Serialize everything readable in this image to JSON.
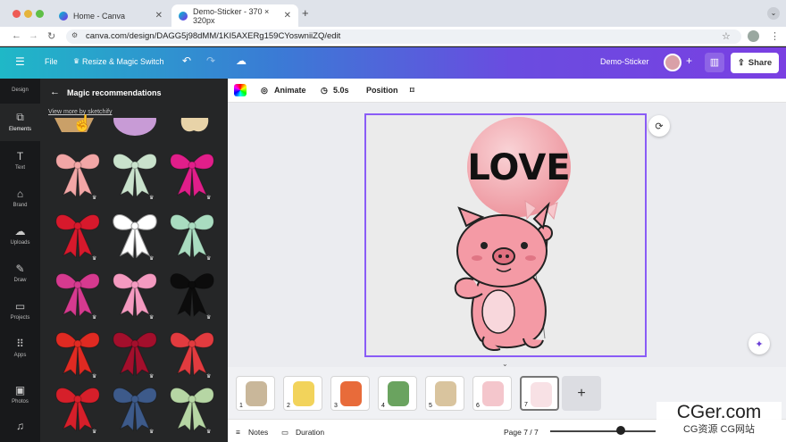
{
  "browser": {
    "tabs": [
      {
        "title": "Home - Canva",
        "active": false
      },
      {
        "title": "Demo-Sticker - 370 × 320px",
        "active": true
      }
    ],
    "new_tab": "+",
    "url": "canva.com/design/DAGG5j98dMM/1KI5AXERg159CYoswniiZQ/edit"
  },
  "topbar": {
    "menu_icon": "hamburger-icon",
    "file": "File",
    "resize": "Resize & Magic Switch",
    "design_name": "Demo-Sticker",
    "share": "Share"
  },
  "rail": {
    "items": [
      {
        "label": "Design",
        "icon": "design-icon"
      },
      {
        "label": "Elements",
        "icon": "elements-icon"
      },
      {
        "label": "Text",
        "icon": "text-icon"
      },
      {
        "label": "Brand",
        "icon": "brand-icon"
      },
      {
        "label": "Uploads",
        "icon": "uploads-icon"
      },
      {
        "label": "Draw",
        "icon": "draw-icon"
      },
      {
        "label": "Projects",
        "icon": "projects-icon"
      },
      {
        "label": "Apps",
        "icon": "apps-icon"
      },
      {
        "label": "Photos",
        "icon": "photos-icon"
      },
      {
        "label": "",
        "icon": "audio-icon"
      }
    ]
  },
  "panel": {
    "title": "Magic recommendations",
    "view_more": "View more by sketchify"
  },
  "toolbar": {
    "animate": "Animate",
    "duration": "5.0s",
    "position": "Position"
  },
  "canvas": {
    "balloon_text": "LOVE"
  },
  "pages": [
    "1",
    "2",
    "3",
    "4",
    "5",
    "6",
    "7"
  ],
  "footer": {
    "notes": "Notes",
    "duration": "Duration",
    "page_indicator": "Page 7 / 7"
  },
  "watermark": {
    "line1": "CGer.com",
    "line2": "CG资源 CG网站"
  },
  "colors": {
    "accent": "#8a5cf6",
    "panel_bg": "#252627"
  }
}
